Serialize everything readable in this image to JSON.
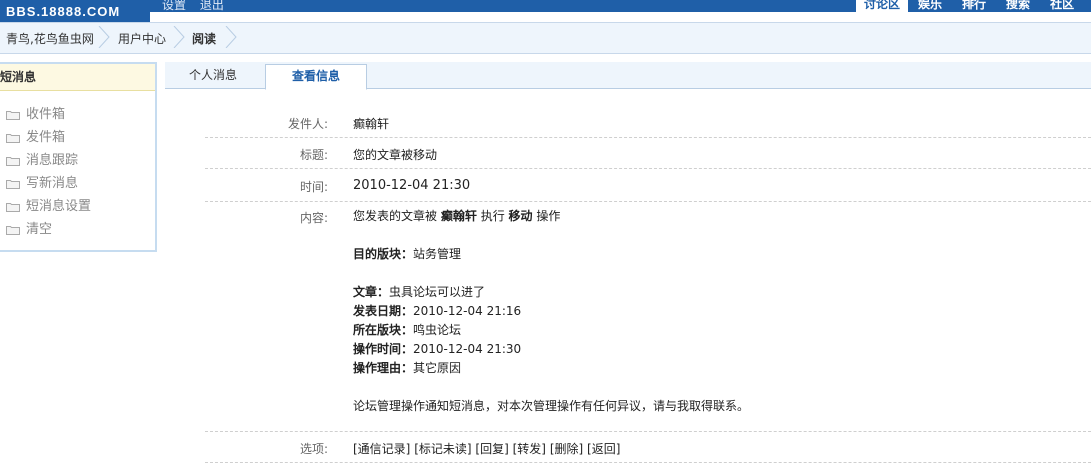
{
  "top": {
    "logo": "BBS.18888.COM",
    "links": [
      "设置",
      "退出"
    ],
    "nav_active": "讨论区",
    "nav_links": [
      "娱乐",
      "排行",
      "搜索",
      "社区"
    ]
  },
  "breadcrumb": [
    "青鸟,花鸟鱼虫网",
    "用户中心",
    "阅读"
  ],
  "sidebar": {
    "title": "短消息",
    "items": [
      "收件箱",
      "发件箱",
      "消息跟踪",
      "写新消息",
      "短消息设置",
      "清空"
    ]
  },
  "tabs": [
    "个人消息",
    "查看信息"
  ],
  "message": {
    "sender_label": "发件人:",
    "sender": "癫翰轩",
    "subject_label": "标题:",
    "subject": "您的文章被移动",
    "time_label": "时间:",
    "time": "2010-12-04 21:30",
    "content_label": "内容:",
    "content": {
      "line1_pre": "您发表的文章被",
      "line1_user": "癫翰轩",
      "line1_mid": "执行",
      "line1_action": "移动",
      "line1_post": "操作",
      "target_label": "目的版块：",
      "target": "站务管理",
      "article_label": "文章：",
      "article": "虫具论坛可以进了",
      "posted_label": "发表日期：",
      "posted": "2010-12-04 21:16",
      "board_label": "所在版块：",
      "board": "鸣虫论坛",
      "optime_label": "操作时间：",
      "optime": "2010-12-04 21:30",
      "reason_label": "操作理由：",
      "reason": "其它原因",
      "footer": "论坛管理操作通知短消息，对本次管理操作有任何异议，请与我取得联系。"
    },
    "options_label": "选项:",
    "options": [
      "[通信记录]",
      "[标记未读]",
      "[回复]",
      "[转发]",
      "[删除]",
      "[返回]"
    ]
  }
}
